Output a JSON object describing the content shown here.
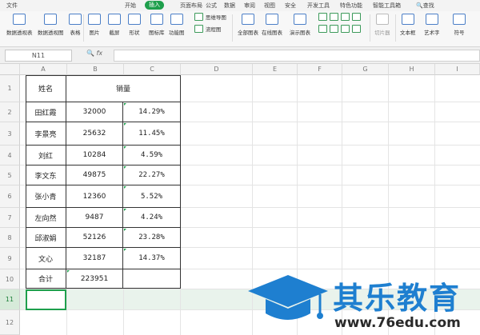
{
  "menubar": {
    "file": "文件",
    "tabs": [
      "开始",
      "插入",
      "页面布局",
      "公式",
      "数据",
      "审阅",
      "视图",
      "安全",
      "开发工具",
      "特色功能",
      "智能工具箱"
    ],
    "active_tab": "插入",
    "search": "查找"
  },
  "ribbon": {
    "buttons": [
      "数据透视表",
      "数据透视图",
      "表格",
      "图片",
      "截屏",
      "形状",
      "图标库",
      "功能图",
      "思维导图",
      "流程图",
      "全部图表",
      "在线图表",
      "演示图表",
      "切片器",
      "文本框",
      "艺术字",
      "符号"
    ]
  },
  "formula_bar": {
    "name_box": "N11",
    "fx": "fx"
  },
  "grid": {
    "columns": [
      "A",
      "B",
      "C",
      "D",
      "E",
      "F",
      "G",
      "H",
      "I"
    ],
    "rows": [
      "1",
      "2",
      "3",
      "4",
      "5",
      "6",
      "7",
      "8",
      "9",
      "10",
      "11",
      "12"
    ]
  },
  "table": {
    "header": {
      "name": "姓名",
      "sales": "销量"
    },
    "rows": [
      {
        "name": "田红霞",
        "value": "32000",
        "pct": "14.29%"
      },
      {
        "name": "李景亮",
        "value": "25632",
        "pct": "11.45%"
      },
      {
        "name": "刘红",
        "value": "10284",
        "pct": "4.59%"
      },
      {
        "name": "李文东",
        "value": "49875",
        "pct": "22.27%"
      },
      {
        "name": "张小青",
        "value": "12360",
        "pct": "5.52%"
      },
      {
        "name": "左向然",
        "value": "9487",
        "pct": "4.24%"
      },
      {
        "name": "邱淑娟",
        "value": "52126",
        "pct": "23.28%"
      },
      {
        "name": "文心",
        "value": "32187",
        "pct": "14.37%"
      }
    ],
    "total": {
      "name": "合计",
      "value": "223951"
    }
  },
  "watermark": {
    "brand": "其乐教育",
    "url": "www.76edu.com"
  },
  "colors": {
    "accent": "#1e9f4c",
    "watermark_blue": "#1e7fd0"
  }
}
